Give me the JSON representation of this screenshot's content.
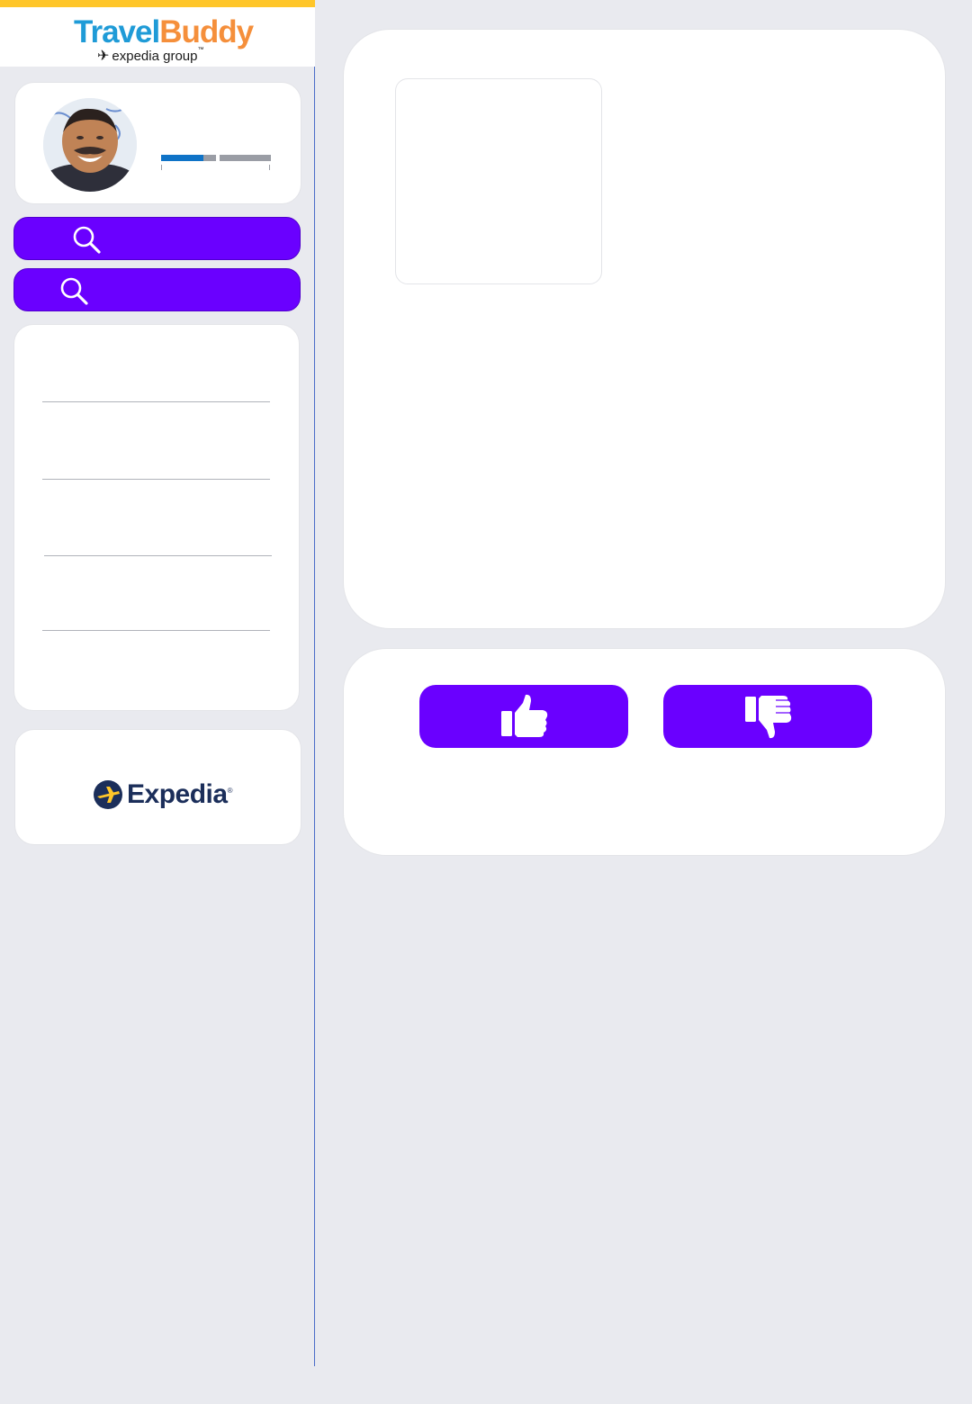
{
  "header": {
    "brand_part1": "Travel",
    "brand_part2": "Buddy",
    "brand_sub": "expedia group",
    "brand_sub_mark": "™",
    "plane_icon": "✈"
  },
  "profile": {
    "avatar_icon": "user-photo",
    "progress": {
      "segment1_fraction": 0.77,
      "segment2_fraction": 0.0
    }
  },
  "sidebar": {
    "search_buttons": [
      {
        "icon": "search-icon",
        "label": ""
      },
      {
        "icon": "search-icon",
        "label": ""
      }
    ],
    "list_items": [
      "",
      "",
      "",
      "",
      ""
    ]
  },
  "ad": {
    "brand": "Expedia",
    "trademark": "®"
  },
  "rating": {
    "like_icon": "thumbs-up-icon",
    "dislike_icon": "thumbs-down-icon"
  },
  "colors": {
    "accent": "#6A00FF",
    "topbar": "#FFC629",
    "progress": "#0F73C7",
    "background": "#E9EAEF"
  }
}
